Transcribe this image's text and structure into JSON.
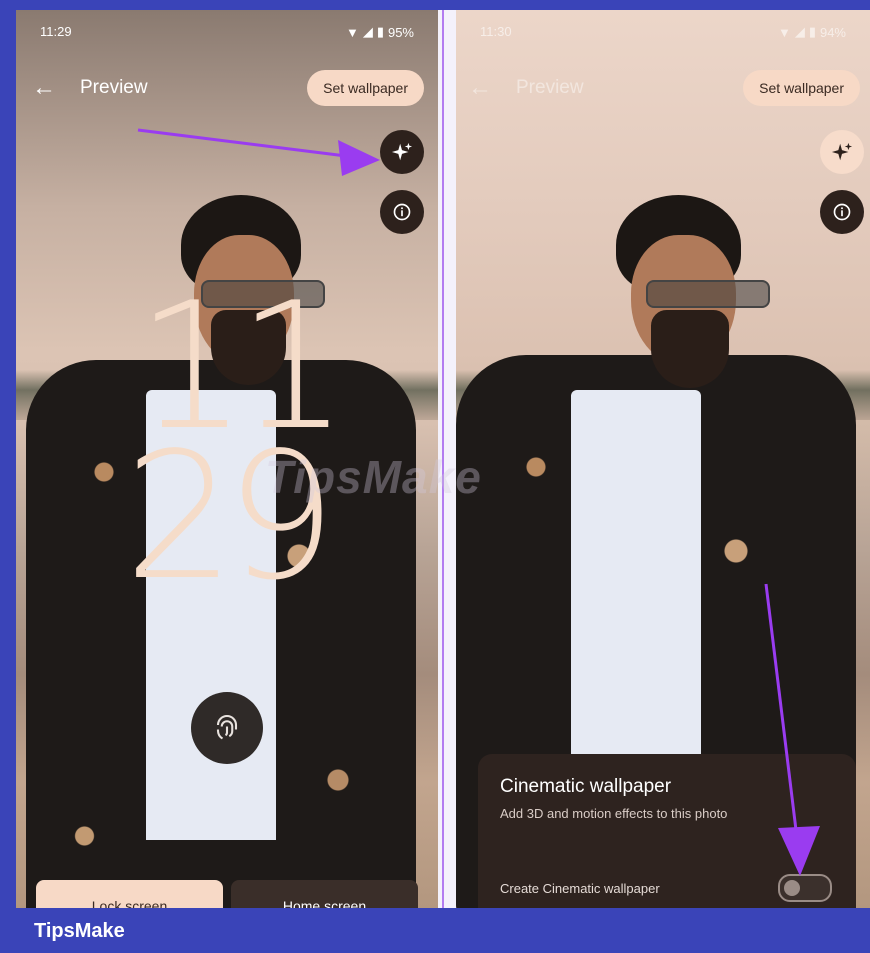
{
  "left_screen": {
    "status": {
      "time": "11:29",
      "battery": "95%"
    },
    "appbar": {
      "title": "Preview",
      "set_wallpaper": "Set wallpaper"
    },
    "clock": {
      "hour": "11",
      "minute": "29"
    },
    "tabs": [
      {
        "label": "Lock screen"
      },
      {
        "label": "Home screen"
      }
    ]
  },
  "right_screen": {
    "status": {
      "time": "11:30",
      "battery": "94%"
    },
    "appbar": {
      "title": "Preview",
      "set_wallpaper": "Set wallpaper"
    },
    "sheet": {
      "title": "Cinematic wallpaper",
      "subtitle": "Add 3D and motion effects to this photo",
      "toggle_label": "Create Cinematic wallpaper",
      "toggle_on": false
    }
  },
  "watermark": "TipsMake",
  "brand": "TipsMake",
  "icons": {
    "back": "arrow-left-icon",
    "sparkle": "sparkle-icon",
    "info": "info-icon",
    "fingerprint": "fingerprint-icon",
    "wifi": "wifi-icon",
    "signal": "signal-icon",
    "battery": "battery-icon"
  },
  "colors": {
    "accent": "#f7d9c6",
    "annotation": "#9a3cf0",
    "frame": "#3a44b8"
  }
}
